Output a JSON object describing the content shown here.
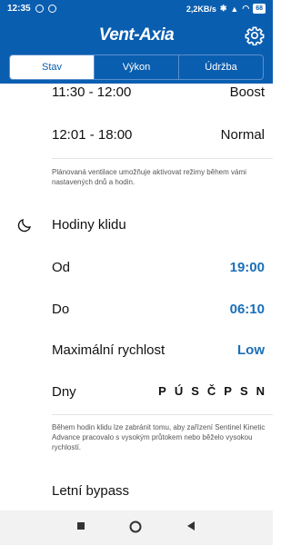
{
  "status_bar": {
    "time": "12:35",
    "notif_1": "",
    "notif_2": "",
    "net_speed": "2,2KB/s",
    "battery": "68"
  },
  "app": {
    "logo": "Vent-Axia",
    "settings_icon": "gear-icon"
  },
  "tabs": [
    {
      "label": "Stav",
      "active": true
    },
    {
      "label": "Výkon",
      "active": false
    },
    {
      "label": "Údržba",
      "active": false
    }
  ],
  "schedule": [
    {
      "time": "11:30 - 12:00",
      "mode": "Boost"
    },
    {
      "time": "12:01 - 18:00",
      "mode": "Normal"
    }
  ],
  "schedule_note": "Plánovaná ventilace umožňuje aktivovat režimy během vámi nastavených dnů a hodin.",
  "quiet_hours": {
    "title": "Hodiny klidu",
    "icon": "moon-icon",
    "from_label": "Od",
    "from_value": "19:00",
    "to_label": "Do",
    "to_value": "06:10",
    "max_speed_label": "Maximální rychlost",
    "max_speed_value": "Low",
    "days_label": "Dny",
    "days": [
      "P",
      "Ú",
      "S",
      "Č",
      "P",
      "S",
      "N"
    ],
    "note": "Během hodin klidu lze zabránit tomu, aby zařízení Sentinel Kinetic Advance pracovalo s vysokým průtokem nebo běželo vysokou rychlostí."
  },
  "summer_bypass": {
    "label": "Letní bypass"
  },
  "colors": {
    "brand_blue": "#0a5eb0",
    "value_blue": "#1a6fb8"
  }
}
